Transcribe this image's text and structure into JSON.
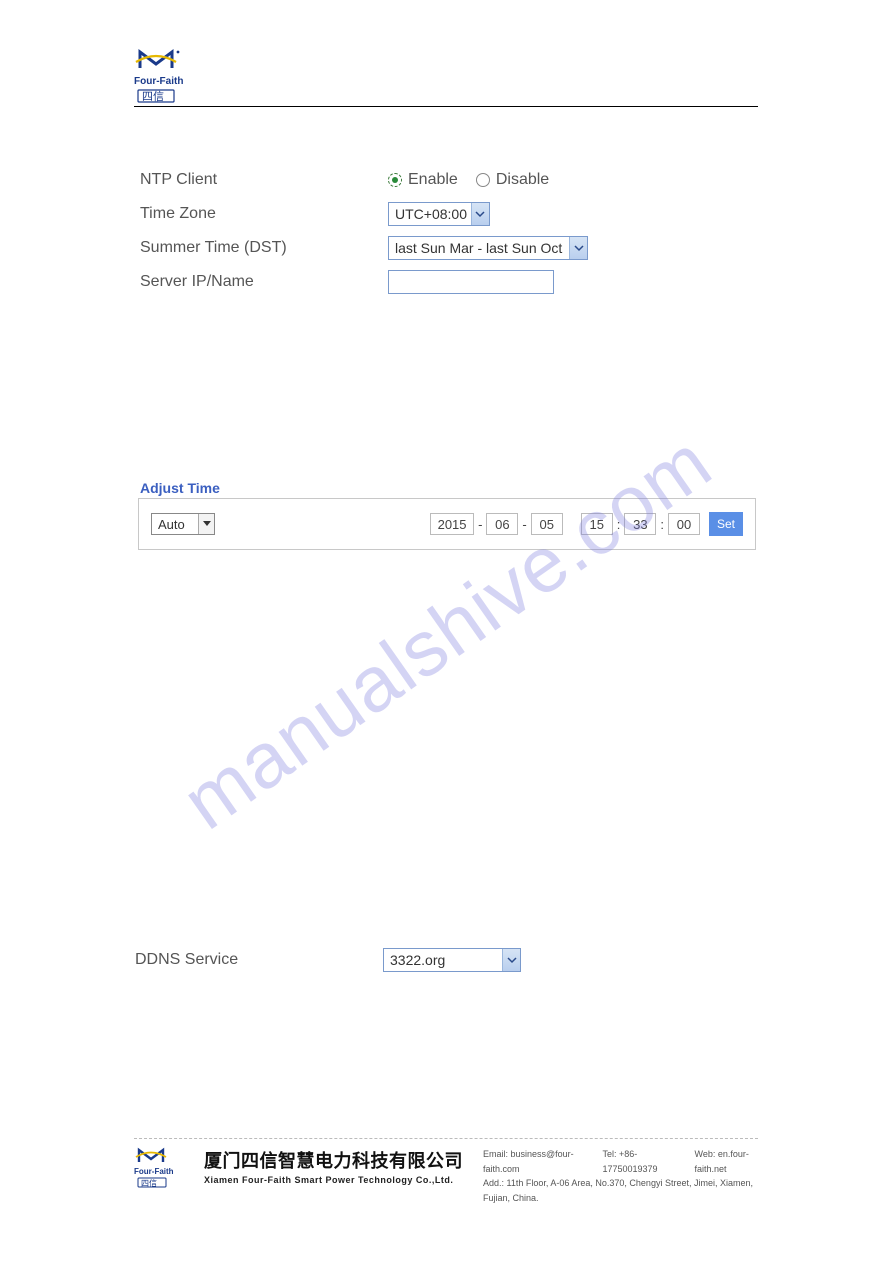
{
  "brand": "Four-Faith",
  "watermark": "manualshive.com",
  "ntp": {
    "label": "NTP Client",
    "enable_label": "Enable",
    "disable_label": "Disable",
    "selected": "enable"
  },
  "timezone": {
    "label": "Time Zone",
    "value": "UTC+08:00"
  },
  "dst": {
    "label": "Summer Time (DST)",
    "value": "last Sun Mar - last Sun Oct"
  },
  "server": {
    "label": "Server IP/Name",
    "value": ""
  },
  "adjust_time": {
    "legend": "Adjust Time",
    "mode": "Auto",
    "year": "2015",
    "month": "06",
    "day": "05",
    "hour": "15",
    "minute": "33",
    "second": "00",
    "set_label": "Set"
  },
  "ddns": {
    "label": "DDNS Service",
    "value": "3322.org"
  },
  "footer": {
    "company_cn": "厦门四信智慧电力科技有限公司",
    "company_en": "Xiamen Four-Faith Smart Power Technology Co.,Ltd.",
    "email_label": "Email: ",
    "email": "business@four-faith.com",
    "tel_label": "Tel: ",
    "tel": "+86-17750019379",
    "web_label": "Web: ",
    "web": "en.four-faith.net",
    "addr_label": "Add.: ",
    "addr": "11th Floor, A-06 Area, No.370, Chengyi Street, Jimei, Xiamen, Fujian, China."
  }
}
